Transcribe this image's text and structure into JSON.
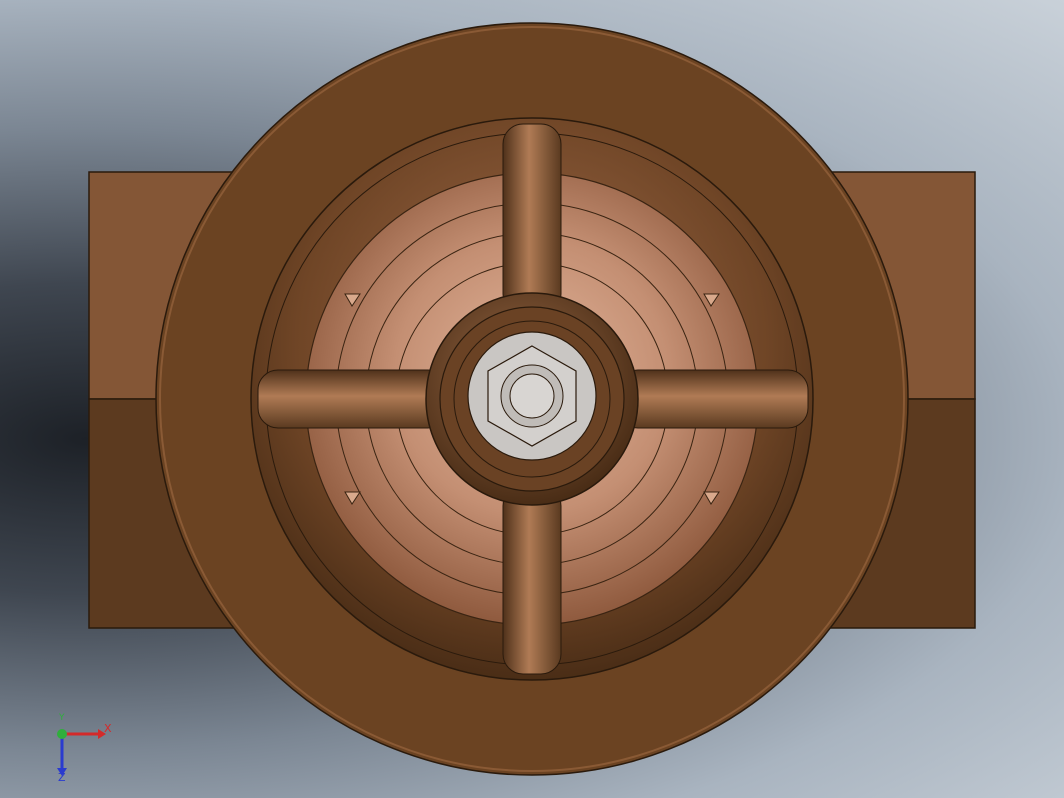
{
  "view": {
    "background_top": "#c9d1d9",
    "background_dark": "#1d2127"
  },
  "model": {
    "name": "valve-handwheel-top-view",
    "colors": {
      "body_light": "#845636",
      "body_dark": "#5a3a20",
      "rim": "#6e4524",
      "spoke": "#7a4e2d",
      "inner_disk": "#c48f73",
      "nut": "#c8c6c4"
    }
  },
  "triad": {
    "x_label": "X",
    "y_label": "Y",
    "z_label": "Z",
    "x_color": "#d42a2a",
    "y_color": "#2fae3c",
    "z_color": "#2a3bcf"
  }
}
